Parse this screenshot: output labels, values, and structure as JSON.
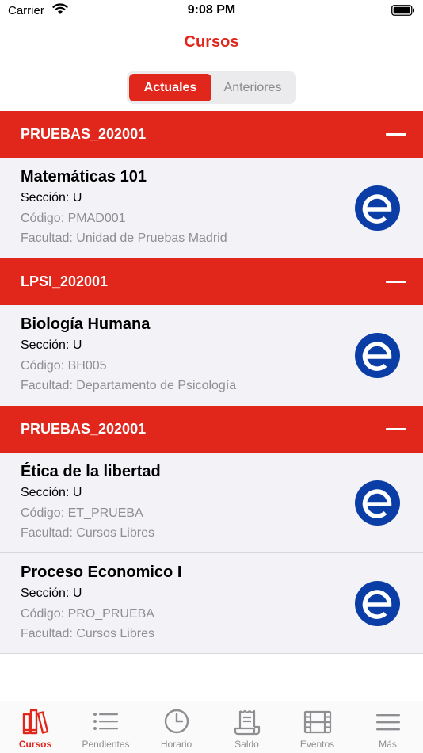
{
  "status_bar": {
    "carrier": "Carrier",
    "time": "9:08 PM"
  },
  "header": {
    "title": "Cursos"
  },
  "segments": [
    {
      "label": "Actuales",
      "active": true
    },
    {
      "label": "Anteriores",
      "active": false
    }
  ],
  "sections": [
    {
      "title": "PRUEBAS_202001",
      "courses": [
        {
          "name": "Matemáticas 101",
          "section": "Sección: U",
          "code": "Código: PMAD001",
          "faculty": "Facultad: Unidad de Pruebas Madrid"
        }
      ]
    },
    {
      "title": "LPSI_202001",
      "courses": [
        {
          "name": "Biología Humana",
          "section": "Sección: U",
          "code": "Código: BH005",
          "faculty": "Facultad: Departamento de Psicología"
        }
      ]
    },
    {
      "title": "PRUEBAS_202001",
      "courses": [
        {
          "name": "Ética de la libertad",
          "section": "Sección: U",
          "code": "Código: ET_PRUEBA",
          "faculty": "Facultad: Cursos Libres"
        },
        {
          "name": "Proceso Economico I",
          "section": "Sección: U",
          "code": "Código: PRO_PRUEBA",
          "faculty": "Facultad: Cursos Libres"
        }
      ]
    }
  ],
  "tabs": [
    {
      "label": "Cursos",
      "icon": "books-icon",
      "active": true
    },
    {
      "label": "Pendientes",
      "icon": "list-icon",
      "active": false
    },
    {
      "label": "Horario",
      "icon": "clock-icon",
      "active": false
    },
    {
      "label": "Saldo",
      "icon": "receipt-icon",
      "active": false
    },
    {
      "label": "Eventos",
      "icon": "film-icon",
      "active": false
    },
    {
      "label": "Más",
      "icon": "menu-icon",
      "active": false
    }
  ],
  "colors": {
    "accent": "#e1261c",
    "course_logo": "#0a3ea6",
    "row_bg": "#f2f2f7",
    "muted_text": "#8e8e93"
  }
}
